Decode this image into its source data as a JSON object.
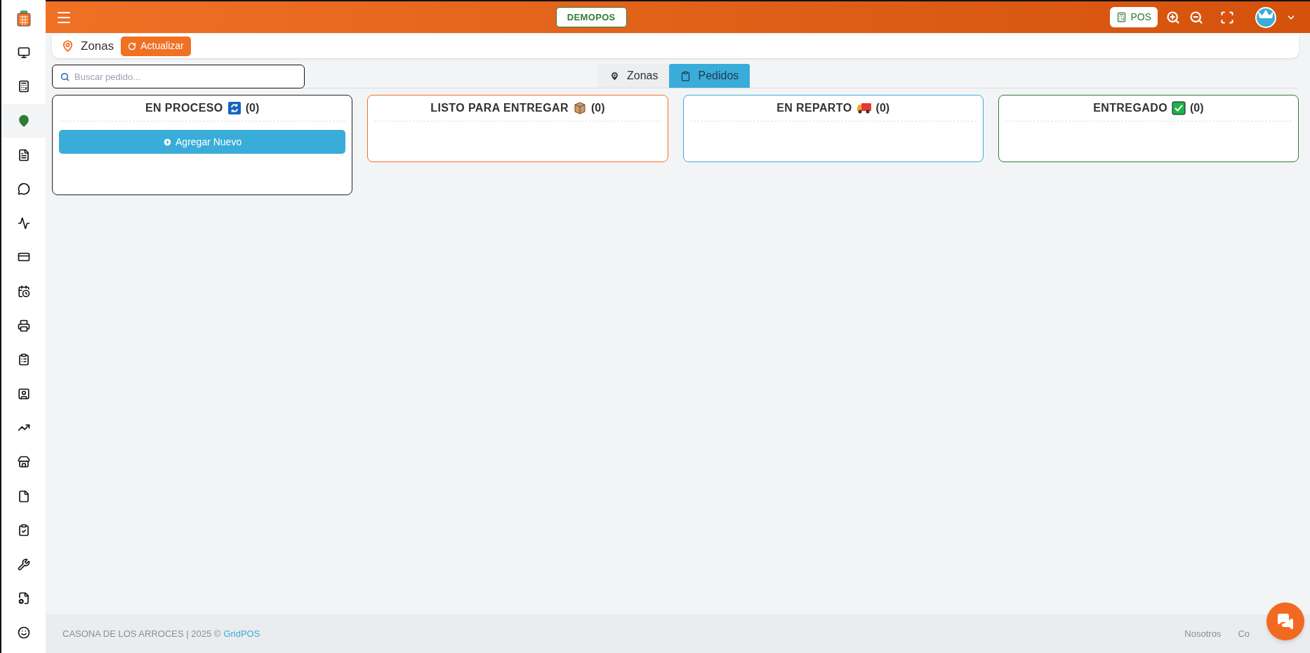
{
  "topbar": {
    "brand": "DEMOPOS",
    "pos_button": "POS"
  },
  "sidebar": {
    "items": [
      {
        "selected": false
      },
      {
        "selected": false
      },
      {
        "selected": false
      },
      {
        "selected": true
      },
      {
        "selected": false
      },
      {
        "selected": false
      },
      {
        "selected": false
      },
      {
        "selected": false
      },
      {
        "selected": false
      },
      {
        "selected": false
      },
      {
        "selected": false
      },
      {
        "selected": false
      },
      {
        "selected": false
      },
      {
        "selected": false
      },
      {
        "selected": false
      },
      {
        "selected": false
      },
      {
        "selected": false
      },
      {
        "selected": false
      },
      {
        "selected": false
      }
    ]
  },
  "breadcrumb": {
    "title": "Zonas",
    "refresh_button": "Actualizar"
  },
  "search": {
    "placeholder": "Buscar pedido..."
  },
  "tabs": [
    {
      "label": "Zonas",
      "selected": false
    },
    {
      "label": "Pedidos",
      "selected": true
    }
  ],
  "columns": [
    {
      "kind": "process",
      "title": "EN PROCESO",
      "count": "(0)",
      "color": "#222222",
      "add_button": "Agregar Nuevo"
    },
    {
      "kind": "ready",
      "title": "LISTO PARA ENTREGAR",
      "count": "(0)",
      "color": "#f36f21"
    },
    {
      "kind": "delivery",
      "title": "EN REPARTO",
      "count": "(0)",
      "color": "#3aacd9"
    },
    {
      "kind": "done",
      "title": "ENTREGADO",
      "count": "(0)",
      "color": "#2e7d32"
    }
  ],
  "footer": {
    "company": "CASONA DE LOS ARROCES | 2025 ©",
    "brand_link": "GridPOS",
    "links": [
      "Nosotros",
      "Co"
    ]
  }
}
